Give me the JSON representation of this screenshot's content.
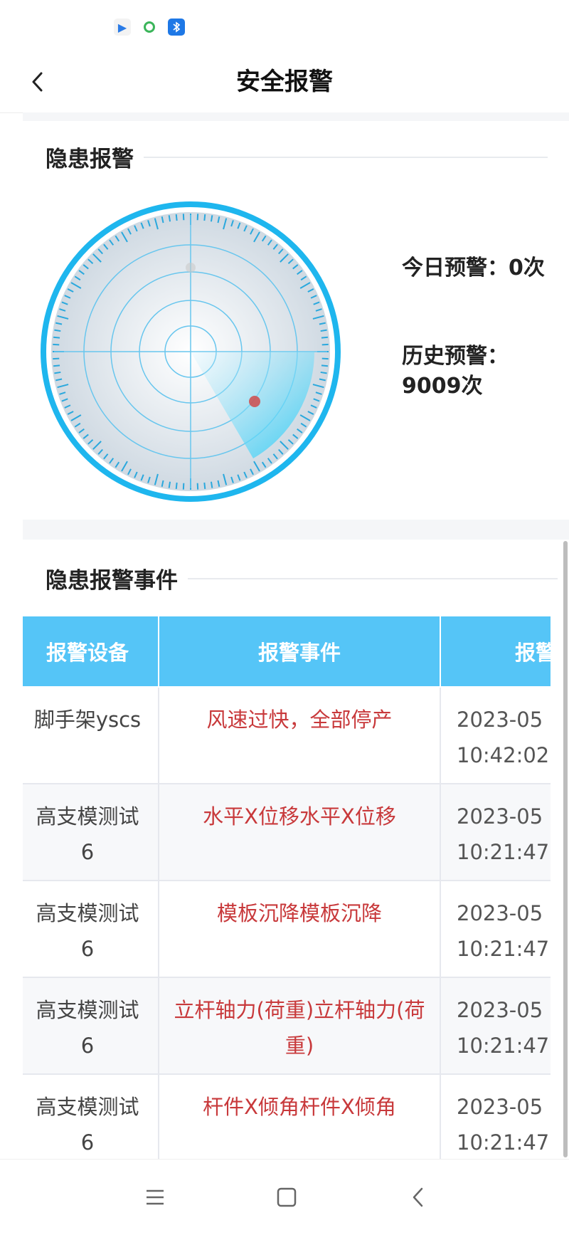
{
  "status_bar": {
    "icons": [
      "play-store-icon",
      "green-ring-app-icon",
      "bluetooth-icon"
    ]
  },
  "nav": {
    "title": "安全报警",
    "back_icon": "chevron-left-icon"
  },
  "hazard_alarm": {
    "title": "隐患报警",
    "today_label": "今日预警：",
    "today_value": "0次",
    "history_label": "历史预警：",
    "history_value": "9009次"
  },
  "alarm_events": {
    "title": "隐患报警事件",
    "columns": [
      "报警设备",
      "报警事件",
      "报警"
    ],
    "rows": [
      {
        "device": "脚手架yscs",
        "event": "风速过快，全部停产",
        "date": "2023-05",
        "time": "10:42:02"
      },
      {
        "device": "高支模测试6",
        "event": "水平X位移水平X位移",
        "date": "2023-05",
        "time": "10:21:47"
      },
      {
        "device": "高支模测试6",
        "event": "模板沉降模板沉降",
        "date": "2023-05",
        "time": "10:21:47"
      },
      {
        "device": "高支模测试6",
        "event": "立杆轴力(荷重)立杆轴力(荷重)",
        "date": "2023-05",
        "time": "10:21:47"
      },
      {
        "device": "高支模测试6",
        "event": "杆件X倾角杆件X倾角",
        "date": "2023-05",
        "time": "10:21:47"
      }
    ]
  },
  "bottom_nav": {
    "icons": [
      "menu-icon",
      "home-square-icon",
      "back-triangle-icon"
    ]
  },
  "colors": {
    "accent_blue": "#55c5f7",
    "alarm_red": "#c8393b",
    "radar_ring": "#1eb6ee"
  }
}
